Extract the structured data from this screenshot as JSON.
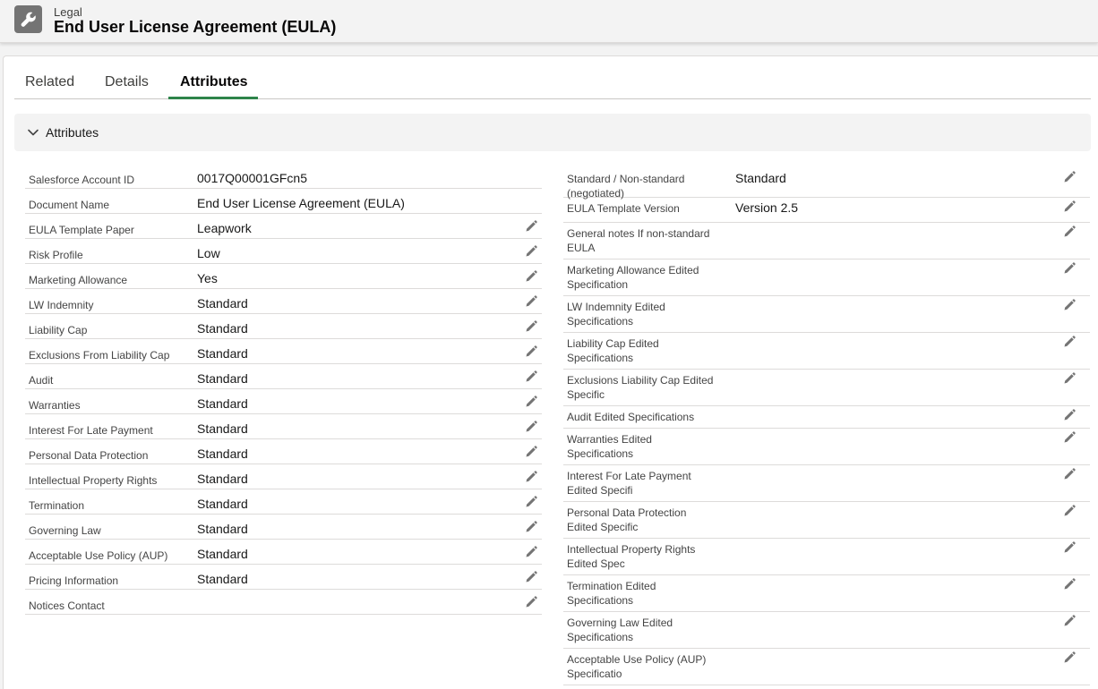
{
  "header": {
    "eyebrow": "Legal",
    "title": "End User License Agreement (EULA)",
    "icon": "wrench-icon"
  },
  "tabs": [
    {
      "label": "Related",
      "active": false
    },
    {
      "label": "Details",
      "active": false
    },
    {
      "label": "Attributes",
      "active": true
    }
  ],
  "section": {
    "title": "Attributes",
    "expanded": true
  },
  "left_fields": [
    {
      "label": "Salesforce Account ID",
      "value": "0017Q00001GFcn5",
      "editable": false
    },
    {
      "label": "Document Name",
      "value": "End User License Agreement (EULA)",
      "editable": false
    },
    {
      "label": "EULA Template Paper",
      "value": "Leapwork",
      "editable": true
    },
    {
      "label": "Risk Profile",
      "value": "Low",
      "editable": true
    },
    {
      "label": "Marketing Allowance",
      "value": "Yes",
      "editable": true
    },
    {
      "label": "LW Indemnity",
      "value": "Standard",
      "editable": true
    },
    {
      "label": "Liability Cap",
      "value": "Standard",
      "editable": true
    },
    {
      "label": "Exclusions From Liability Cap",
      "value": "Standard",
      "editable": true
    },
    {
      "label": "Audit",
      "value": "Standard",
      "editable": true
    },
    {
      "label": "Warranties",
      "value": "Standard",
      "editable": true
    },
    {
      "label": "Interest For Late Payment",
      "value": "Standard",
      "editable": true
    },
    {
      "label": "Personal Data Protection",
      "value": "Standard",
      "editable": true
    },
    {
      "label": "Intellectual Property Rights",
      "value": "Standard",
      "editable": true
    },
    {
      "label": "Termination",
      "value": "Standard",
      "editable": true
    },
    {
      "label": "Governing Law",
      "value": "Standard",
      "editable": true
    },
    {
      "label": "Acceptable Use Policy (AUP)",
      "value": "Standard",
      "editable": true
    },
    {
      "label": "Pricing Information",
      "value": "Standard",
      "editable": true
    },
    {
      "label": "Notices Contact",
      "value": "",
      "editable": true
    }
  ],
  "right_fields": [
    {
      "label": "Standard / Non-standard (negotiated)",
      "value": "Standard",
      "editable": true
    },
    {
      "label": "EULA Template Version",
      "value": "Version 2.5",
      "editable": true
    },
    {
      "label": "General notes If non-standard EULA",
      "value": "",
      "editable": true
    },
    {
      "label": "Marketing Allowance Edited Specification",
      "value": "",
      "editable": true
    },
    {
      "label": "LW Indemnity Edited Specifications",
      "value": "",
      "editable": true
    },
    {
      "label": "Liability Cap Edited Specifications",
      "value": "",
      "editable": true
    },
    {
      "label": "Exclusions Liability Cap Edited Specific",
      "value": "",
      "editable": true
    },
    {
      "label": "Audit Edited Specifications",
      "value": "",
      "editable": true
    },
    {
      "label": "Warranties Edited Specifications",
      "value": "",
      "editable": true
    },
    {
      "label": "Interest For Late Payment Edited Specifi",
      "value": "",
      "editable": true
    },
    {
      "label": "Personal Data Protection Edited Specific",
      "value": "",
      "editable": true
    },
    {
      "label": "Intellectual Property Rights Edited Spec",
      "value": "",
      "editable": true
    },
    {
      "label": "Termination Edited Specifications",
      "value": "",
      "editable": true
    },
    {
      "label": "Governing Law Edited Specifications",
      "value": "",
      "editable": true
    },
    {
      "label": "Acceptable Use Policy (AUP) Specificatio",
      "value": "",
      "editable": true
    }
  ],
  "colors": {
    "active_tab_underline": "#2e844a",
    "header_icon_bg": "#747474"
  }
}
